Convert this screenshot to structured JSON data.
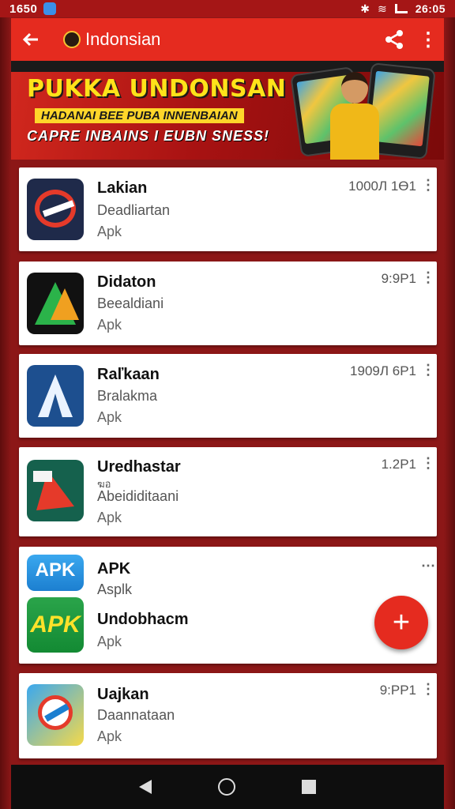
{
  "status_bar": {
    "time_left": "1650",
    "time_right": "26:05"
  },
  "app_bar": {
    "title": "Indonsian",
    "back_icon": "arrow-left-icon",
    "share_icon": "share-icon",
    "more_icon": "more-vert-icon"
  },
  "banner": {
    "headline": "PUKKA UNDONSAN",
    "tagline": "HADANAI BEE PUBA INNENBAIAN",
    "subline": "CAPRE INBAINS I EUBN SNESS!"
  },
  "apps": [
    {
      "name": "Lakian",
      "developer": "Deadliartan",
      "type": "Apk",
      "meta": "1000Л 1Ө1"
    },
    {
      "name": "Didaton",
      "developer": "Beealdiani",
      "type": "Apk",
      "meta": "9:9P1"
    },
    {
      "name": "Raľkaan",
      "developer": "Bralakma",
      "type": "Apk",
      "meta": "1909Л 6P1"
    },
    {
      "name": "Uredhastar",
      "tag": "ฆอ",
      "developer": "Abeididitaani",
      "type": "Apk",
      "meta": "1.2P1"
    },
    {
      "name": "APK",
      "developer": "Asplk",
      "icon_text": "APK"
    },
    {
      "name": "Undobhacm",
      "type": "Apk",
      "icon_text": "APK"
    },
    {
      "name": "Uajkan",
      "developer": "Daannataan",
      "type": "Apk",
      "meta": "9:PP1"
    }
  ],
  "fab": {
    "label": "+"
  },
  "colors": {
    "primary": "#e52b1f",
    "background": "#8c1717",
    "card": "#ffffff"
  }
}
